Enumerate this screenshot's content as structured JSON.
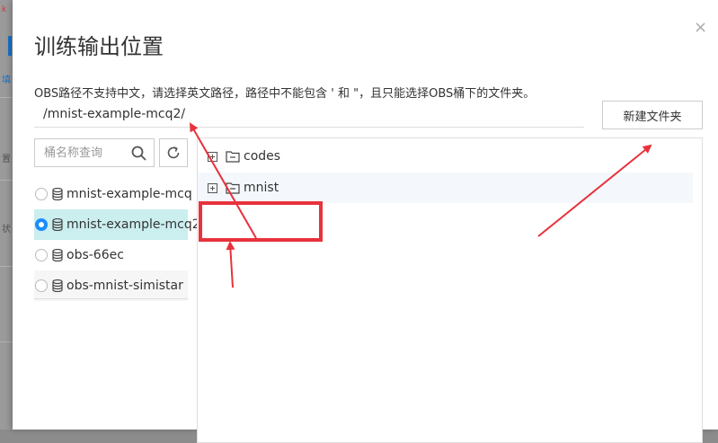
{
  "dialog": {
    "title": "训练输出位置",
    "close_label": "×",
    "hint": "OBS路径不支持中文，请选择英文路径，路径中不能包含 ' 和 \"，且只能选择OBS桶下的文件夹。",
    "path_value": "/mnist-example-mcq2/",
    "new_folder_label": "新建文件夹"
  },
  "search": {
    "placeholder": "桶名称查询"
  },
  "buckets": [
    {
      "label": "mnist-example-mcq",
      "selected": false
    },
    {
      "label": "mnist-example-mcq2",
      "selected": true
    },
    {
      "label": "obs-66ec",
      "selected": false
    },
    {
      "label": "obs-mnist-simistar",
      "selected": false
    }
  ],
  "folders": [
    {
      "label": "codes"
    },
    {
      "label": "mnist"
    }
  ],
  "background": {
    "mark_red": "k",
    "mark_blue": "填",
    "mark_1": "置",
    "mark_2": "状"
  },
  "colors": {
    "accent": "#1a8cff",
    "selected_row": "#cbeeef",
    "annotation": "#e8323c"
  }
}
